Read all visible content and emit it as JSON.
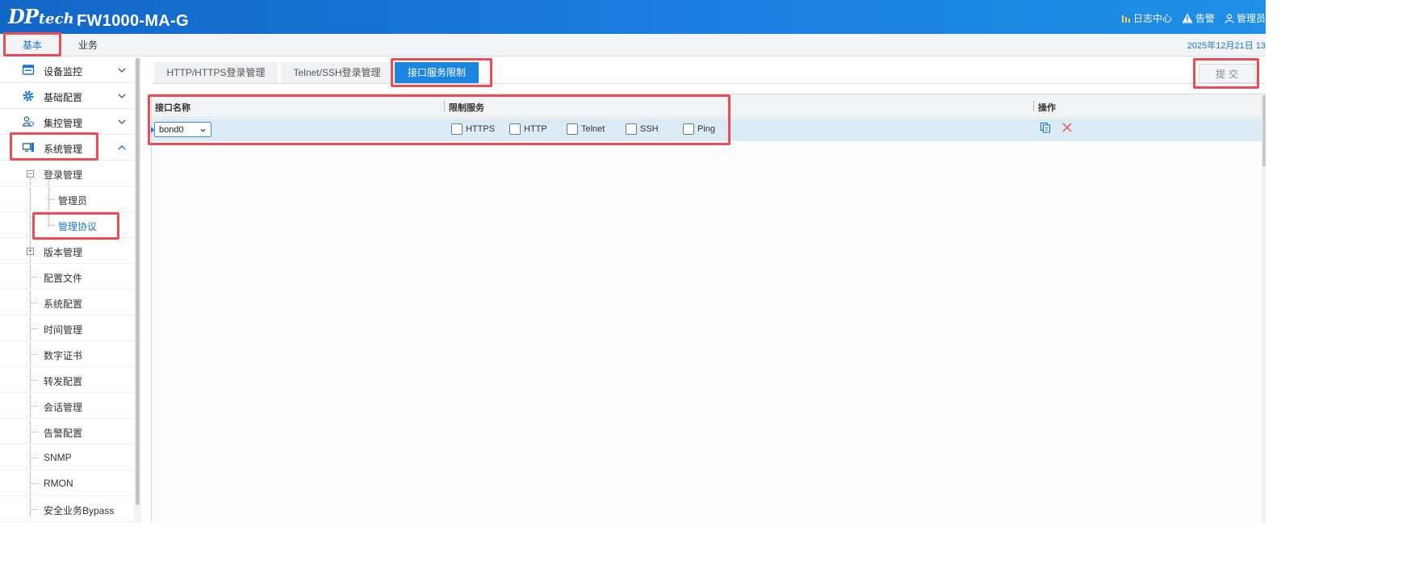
{
  "header": {
    "logo_dp": "DP",
    "logo_tech": "tech",
    "model": "FW1000-MA-G",
    "log_center": "日志中心",
    "alarm": "告警",
    "admin": "管理员"
  },
  "menubar": {
    "tabs": [
      "基本",
      "业务"
    ],
    "datetime": "2025年12月21日 13"
  },
  "sidebar": {
    "top_items": [
      {
        "label": "设备监控",
        "icon": "monitor-icon"
      },
      {
        "label": "基础配置",
        "icon": "gear-icon"
      },
      {
        "label": "集控管理",
        "icon": "people-icon"
      },
      {
        "label": "系统管理",
        "icon": "computer-icon"
      }
    ],
    "tree": [
      {
        "label": "登录管理",
        "expander": "-"
      },
      {
        "label": "管理员"
      },
      {
        "label": "管理协议"
      },
      {
        "label": "版本管理",
        "expander": "+"
      },
      {
        "label": "配置文件"
      },
      {
        "label": "系统配置"
      },
      {
        "label": "时间管理"
      },
      {
        "label": "数字证书"
      },
      {
        "label": "转发配置"
      },
      {
        "label": "会话管理"
      },
      {
        "label": "告警配置"
      },
      {
        "label": "SNMP"
      },
      {
        "label": "RMON"
      },
      {
        "label": "安全业务Bypass"
      }
    ]
  },
  "tabs": [
    "HTTP/HTTPS登录管理",
    "Telnet/SSH登录管理",
    "接口服务限制"
  ],
  "submit_label": "提交",
  "grid": {
    "headers": [
      "接口名称",
      "限制服务",
      "操作"
    ],
    "row": {
      "interface": "bond0",
      "services": [
        {
          "label": "HTTPS",
          "checked": false
        },
        {
          "label": "HTTP",
          "checked": false
        },
        {
          "label": "Telnet",
          "checked": false
        },
        {
          "label": "SSH",
          "checked": false
        },
        {
          "label": "Ping",
          "checked": false
        }
      ]
    }
  },
  "colors": {
    "header_blue": "#1a7ee0",
    "accent": "#1a74d6",
    "highlight_box": "#ef4b55",
    "row_highlight": "#dbecf6"
  }
}
